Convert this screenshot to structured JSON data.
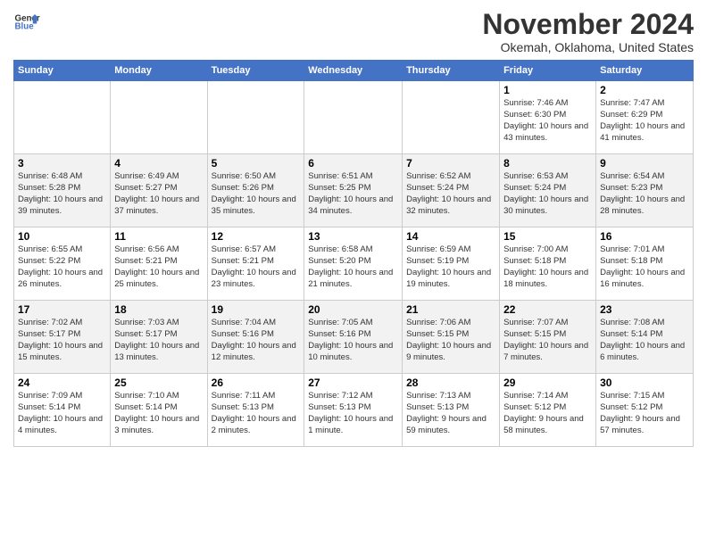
{
  "header": {
    "logo_line1": "General",
    "logo_line2": "Blue",
    "month": "November 2024",
    "location": "Okemah, Oklahoma, United States"
  },
  "days_of_week": [
    "Sunday",
    "Monday",
    "Tuesday",
    "Wednesday",
    "Thursday",
    "Friday",
    "Saturday"
  ],
  "weeks": [
    [
      {
        "day": "",
        "info": ""
      },
      {
        "day": "",
        "info": ""
      },
      {
        "day": "",
        "info": ""
      },
      {
        "day": "",
        "info": ""
      },
      {
        "day": "",
        "info": ""
      },
      {
        "day": "1",
        "info": "Sunrise: 7:46 AM\nSunset: 6:30 PM\nDaylight: 10 hours and 43 minutes."
      },
      {
        "day": "2",
        "info": "Sunrise: 7:47 AM\nSunset: 6:29 PM\nDaylight: 10 hours and 41 minutes."
      }
    ],
    [
      {
        "day": "3",
        "info": "Sunrise: 6:48 AM\nSunset: 5:28 PM\nDaylight: 10 hours and 39 minutes."
      },
      {
        "day": "4",
        "info": "Sunrise: 6:49 AM\nSunset: 5:27 PM\nDaylight: 10 hours and 37 minutes."
      },
      {
        "day": "5",
        "info": "Sunrise: 6:50 AM\nSunset: 5:26 PM\nDaylight: 10 hours and 35 minutes."
      },
      {
        "day": "6",
        "info": "Sunrise: 6:51 AM\nSunset: 5:25 PM\nDaylight: 10 hours and 34 minutes."
      },
      {
        "day": "7",
        "info": "Sunrise: 6:52 AM\nSunset: 5:24 PM\nDaylight: 10 hours and 32 minutes."
      },
      {
        "day": "8",
        "info": "Sunrise: 6:53 AM\nSunset: 5:24 PM\nDaylight: 10 hours and 30 minutes."
      },
      {
        "day": "9",
        "info": "Sunrise: 6:54 AM\nSunset: 5:23 PM\nDaylight: 10 hours and 28 minutes."
      }
    ],
    [
      {
        "day": "10",
        "info": "Sunrise: 6:55 AM\nSunset: 5:22 PM\nDaylight: 10 hours and 26 minutes."
      },
      {
        "day": "11",
        "info": "Sunrise: 6:56 AM\nSunset: 5:21 PM\nDaylight: 10 hours and 25 minutes."
      },
      {
        "day": "12",
        "info": "Sunrise: 6:57 AM\nSunset: 5:21 PM\nDaylight: 10 hours and 23 minutes."
      },
      {
        "day": "13",
        "info": "Sunrise: 6:58 AM\nSunset: 5:20 PM\nDaylight: 10 hours and 21 minutes."
      },
      {
        "day": "14",
        "info": "Sunrise: 6:59 AM\nSunset: 5:19 PM\nDaylight: 10 hours and 19 minutes."
      },
      {
        "day": "15",
        "info": "Sunrise: 7:00 AM\nSunset: 5:18 PM\nDaylight: 10 hours and 18 minutes."
      },
      {
        "day": "16",
        "info": "Sunrise: 7:01 AM\nSunset: 5:18 PM\nDaylight: 10 hours and 16 minutes."
      }
    ],
    [
      {
        "day": "17",
        "info": "Sunrise: 7:02 AM\nSunset: 5:17 PM\nDaylight: 10 hours and 15 minutes."
      },
      {
        "day": "18",
        "info": "Sunrise: 7:03 AM\nSunset: 5:17 PM\nDaylight: 10 hours and 13 minutes."
      },
      {
        "day": "19",
        "info": "Sunrise: 7:04 AM\nSunset: 5:16 PM\nDaylight: 10 hours and 12 minutes."
      },
      {
        "day": "20",
        "info": "Sunrise: 7:05 AM\nSunset: 5:16 PM\nDaylight: 10 hours and 10 minutes."
      },
      {
        "day": "21",
        "info": "Sunrise: 7:06 AM\nSunset: 5:15 PM\nDaylight: 10 hours and 9 minutes."
      },
      {
        "day": "22",
        "info": "Sunrise: 7:07 AM\nSunset: 5:15 PM\nDaylight: 10 hours and 7 minutes."
      },
      {
        "day": "23",
        "info": "Sunrise: 7:08 AM\nSunset: 5:14 PM\nDaylight: 10 hours and 6 minutes."
      }
    ],
    [
      {
        "day": "24",
        "info": "Sunrise: 7:09 AM\nSunset: 5:14 PM\nDaylight: 10 hours and 4 minutes."
      },
      {
        "day": "25",
        "info": "Sunrise: 7:10 AM\nSunset: 5:14 PM\nDaylight: 10 hours and 3 minutes."
      },
      {
        "day": "26",
        "info": "Sunrise: 7:11 AM\nSunset: 5:13 PM\nDaylight: 10 hours and 2 minutes."
      },
      {
        "day": "27",
        "info": "Sunrise: 7:12 AM\nSunset: 5:13 PM\nDaylight: 10 hours and 1 minute."
      },
      {
        "day": "28",
        "info": "Sunrise: 7:13 AM\nSunset: 5:13 PM\nDaylight: 9 hours and 59 minutes."
      },
      {
        "day": "29",
        "info": "Sunrise: 7:14 AM\nSunset: 5:12 PM\nDaylight: 9 hours and 58 minutes."
      },
      {
        "day": "30",
        "info": "Sunrise: 7:15 AM\nSunset: 5:12 PM\nDaylight: 9 hours and 57 minutes."
      }
    ]
  ]
}
